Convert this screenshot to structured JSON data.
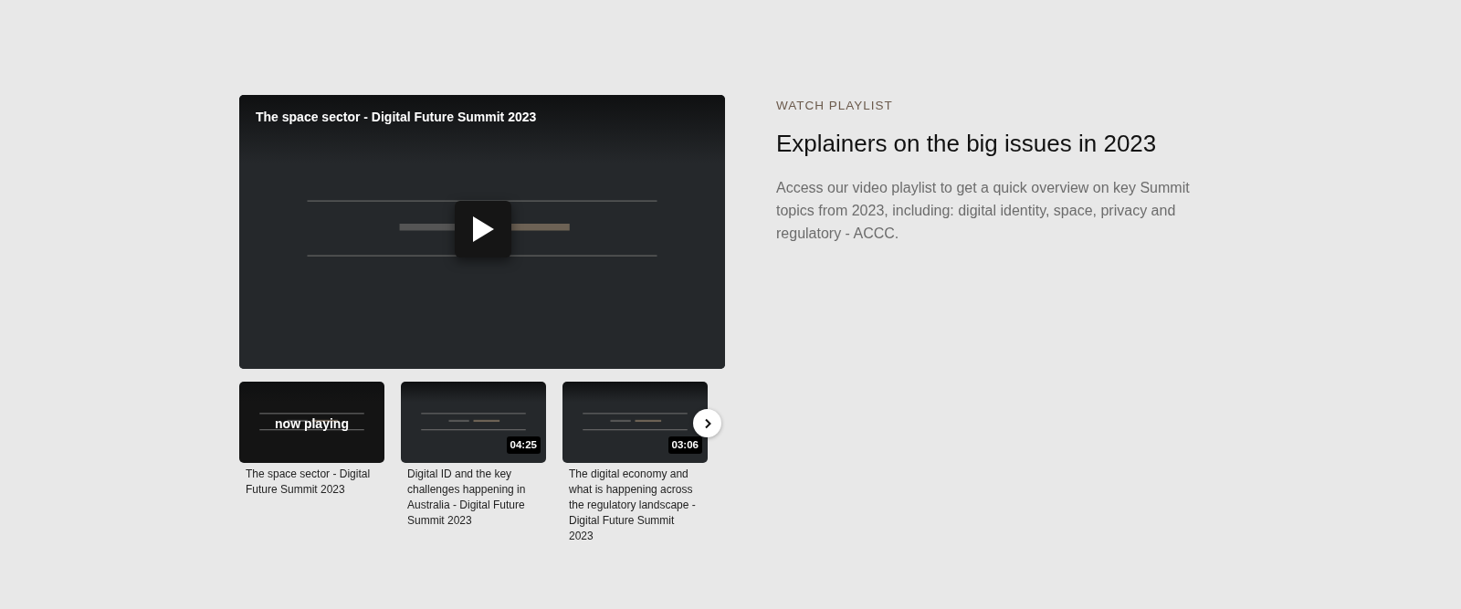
{
  "player": {
    "title": "The space sector - Digital Future Summit 2023"
  },
  "playlist": [
    {
      "title": "The space sector - Digital Future Summit 2023",
      "selected": true,
      "status": "now playing"
    },
    {
      "title": "Digital ID and the key challenges happening in Australia - Digital Future Summit 2023",
      "selected": false,
      "duration": "04:25"
    },
    {
      "title": "The digital economy and what is happening across the regulatory landscape - Digital Future Summit 2023",
      "selected": false,
      "duration": "03:06"
    }
  ],
  "intro": {
    "eyebrow": "WATCH PLAYLIST",
    "heading": "Explainers on the big issues in 2023",
    "description": "Access our video playlist to get a quick overview on key Summit topics from 2023, including: digital identity, space, privacy and regulatory - ACCC."
  }
}
